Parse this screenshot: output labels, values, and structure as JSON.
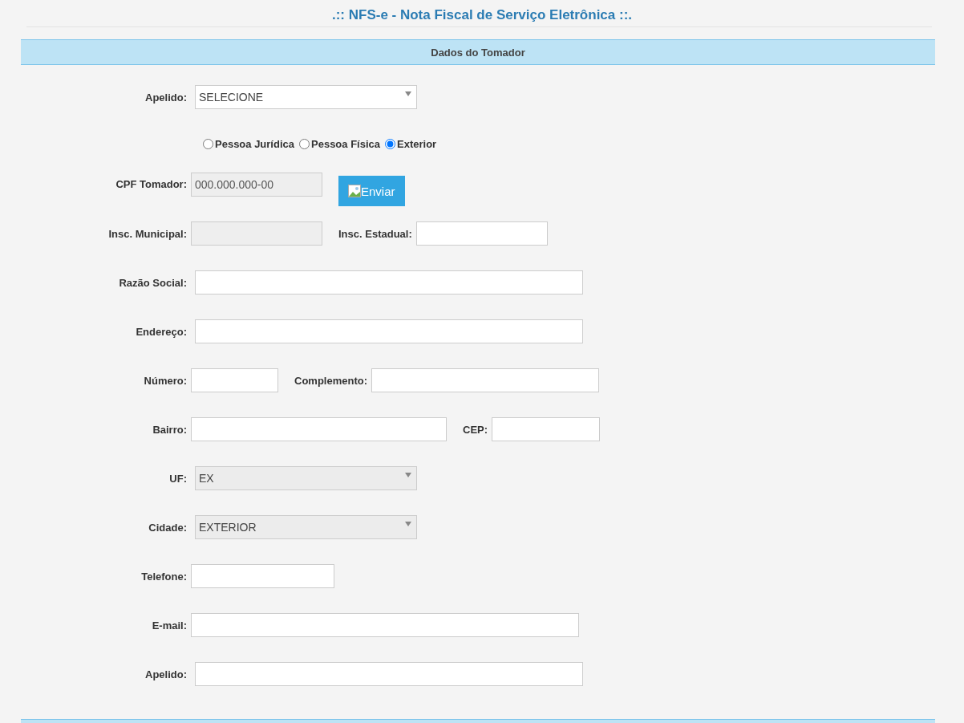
{
  "title": ".:: NFS-e - Nota Fiscal de Serviço Eletrônica ::.",
  "section": {
    "title": "Dados do Tomador"
  },
  "rows": [
    {
      "items": [
        {
          "kind": "select",
          "label": "Apelido:",
          "value": "SELECIONE",
          "disabled": false
        }
      ]
    },
    {
      "items": [
        {
          "kind": "radio",
          "label": "Pessoa Jurídica",
          "selected": false
        },
        {
          "kind": "radio",
          "label": "Pessoa Física",
          "selected": false
        },
        {
          "kind": "radio",
          "label": "Exterior",
          "selected": true
        }
      ]
    },
    {
      "items": [
        {
          "kind": "text",
          "label": "CPF Tomador:",
          "value": "000.000.000-00",
          "disabled": true
        },
        {
          "kind": "button",
          "label": "Enviar"
        }
      ]
    },
    {
      "items": [
        {
          "kind": "text",
          "label": "Insc. Municipal:",
          "disabled": true
        },
        {
          "kind": "text",
          "label": "Insc. Estadual:",
          "disabled": false
        }
      ]
    },
    {
      "items": [
        {
          "kind": "text",
          "label": "Razão Social:",
          "disabled": false
        }
      ]
    },
    {
      "items": [
        {
          "kind": "text",
          "label": "Endereço:",
          "disabled": false
        }
      ]
    },
    {
      "items": [
        {
          "kind": "text",
          "label": "Número:",
          "disabled": false
        },
        {
          "kind": "text",
          "label": "Complemento:",
          "disabled": false
        }
      ]
    },
    {
      "items": [
        {
          "kind": "text",
          "label": "Bairro:",
          "disabled": false
        },
        {
          "kind": "text",
          "label": "CEP:",
          "disabled": false
        }
      ]
    },
    {
      "items": [
        {
          "kind": "select",
          "label": "UF:",
          "value": "EX",
          "disabled": true
        }
      ]
    },
    {
      "items": [
        {
          "kind": "select",
          "label": "Cidade:",
          "value": "EXTERIOR",
          "disabled": true
        }
      ]
    },
    {
      "items": [
        {
          "kind": "text",
          "label": "Telefone:",
          "disabled": false
        }
      ]
    },
    {
      "items": [
        {
          "kind": "text",
          "label": "E-mail:",
          "disabled": false
        }
      ]
    },
    {
      "items": [
        {
          "kind": "text",
          "label": "Apelido:",
          "disabled": false
        }
      ]
    }
  ]
}
